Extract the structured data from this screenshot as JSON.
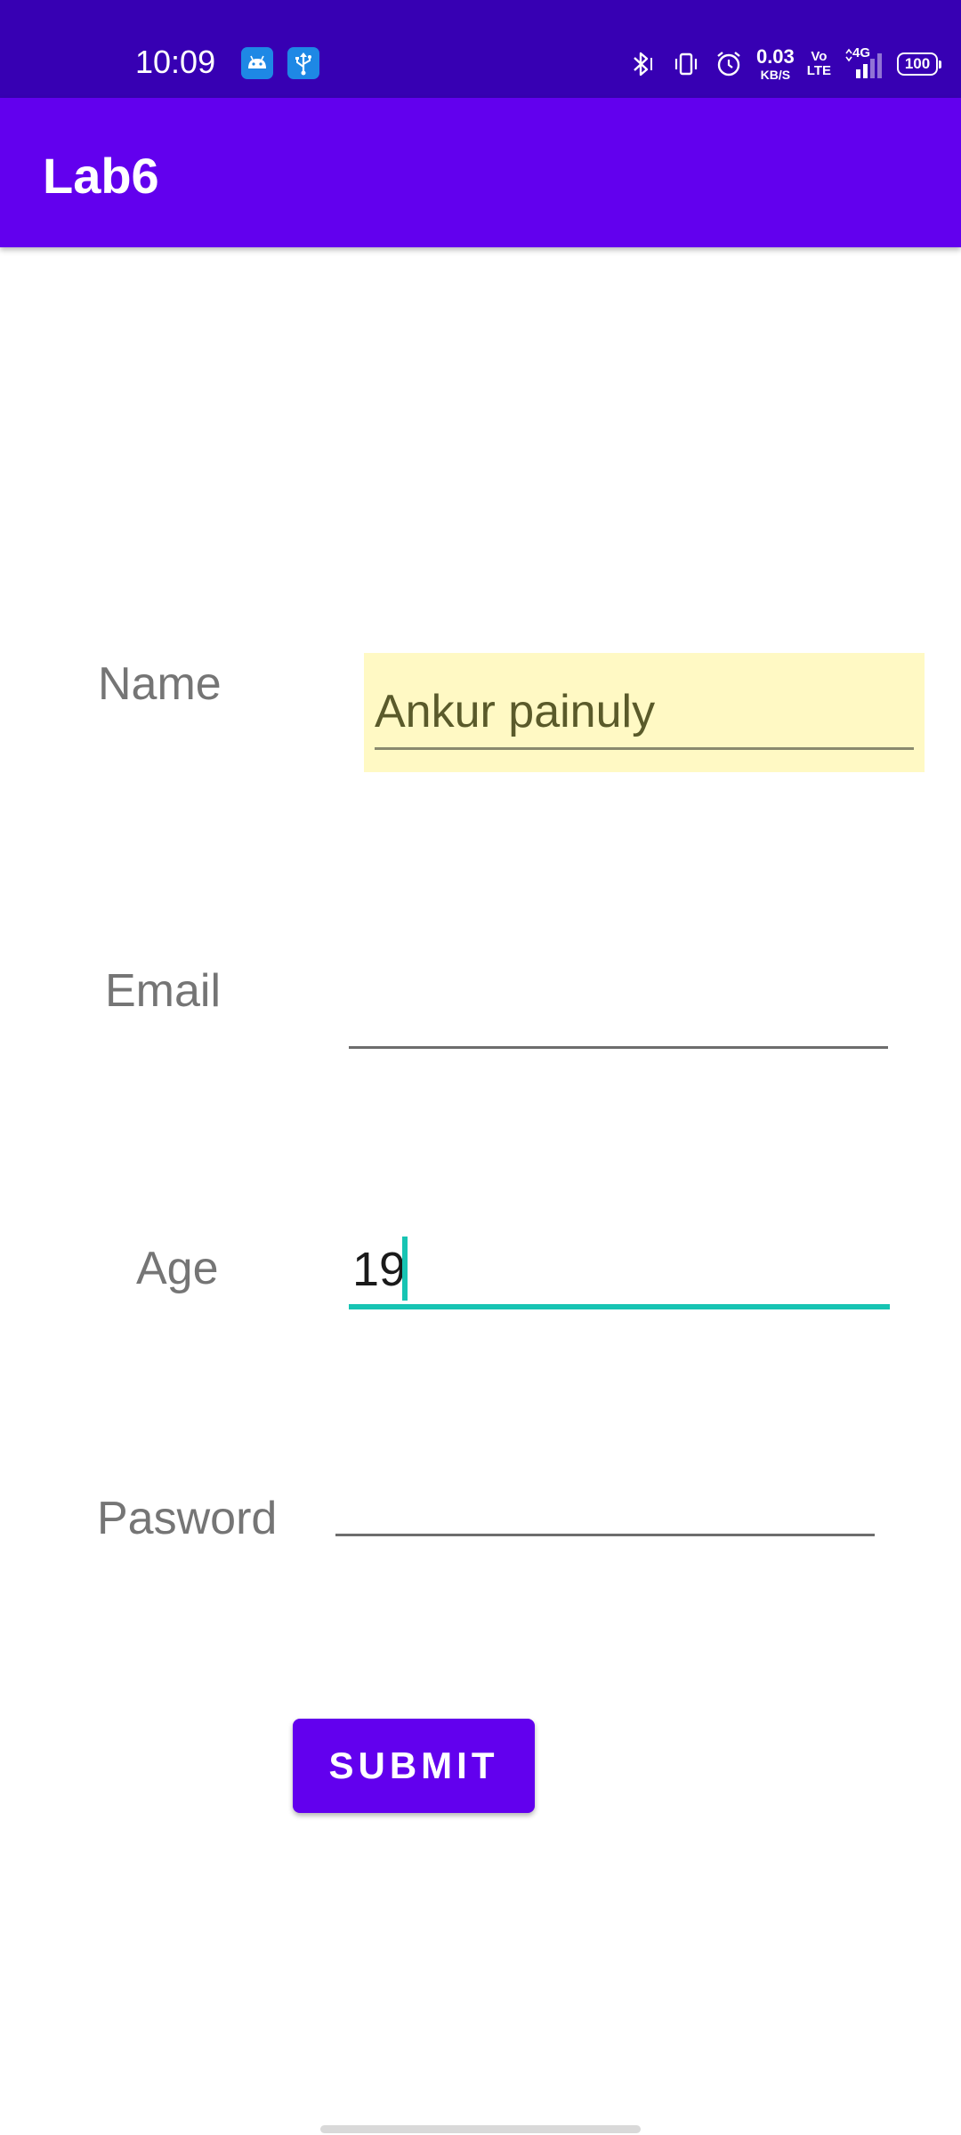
{
  "status_bar": {
    "time": "10:09",
    "net_speed_value": "0.03",
    "net_speed_unit": "KB/S",
    "volte_top": "Vo",
    "volte_bottom": "LTE",
    "network": "4G",
    "battery": "100",
    "notification_icons": [
      "android-icon",
      "usb-icon"
    ],
    "status_icons": [
      "bluetooth-icon",
      "vibrate-icon",
      "alarm-icon",
      "signal-icon"
    ],
    "background": "#3700b3"
  },
  "app_bar": {
    "title": "Lab6",
    "background": "#6200ee"
  },
  "form": {
    "name_label": "Name",
    "name_value": "Ankur painuly",
    "email_label": "Email",
    "email_value": "",
    "age_label": "Age",
    "age_value": "19",
    "password_label": "Pasword",
    "password_value": "",
    "focus_color": "#17c4b3",
    "highlight_color": "#fff9c4"
  },
  "submit_label": "SUBMIT"
}
